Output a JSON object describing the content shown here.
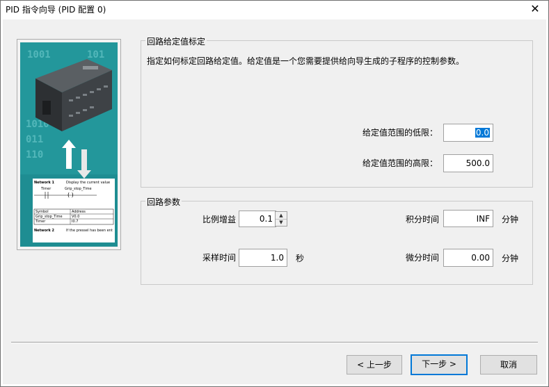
{
  "window": {
    "title": "PID 指令向导 (PID 配置 0)",
    "close_glyph": "✕"
  },
  "illustration": {
    "bits_lines": [
      "1001",
      "101",
      "1010",
      "011",
      "110"
    ],
    "ladder": {
      "network1": "Network 1",
      "network1_comment": "Display the current value",
      "contact": "Timer",
      "coil": "Grip_stop_Time",
      "table_headers": [
        "Symbol",
        "Address"
      ],
      "table_rows": [
        [
          "Grip_stop_Time",
          "V0.0"
        ],
        [
          "Timer",
          "I0.7"
        ]
      ],
      "network2": "Network 2",
      "network2_comment": "If the pressel has been ent"
    }
  },
  "setpoint_group": {
    "legend": "回路给定值标定",
    "description": "指定如何标定回路给定值。给定值是一个您需要提供给向导生成的子程序的控制参数。",
    "low_label": "给定值范围的低限：",
    "low_value": "0.0",
    "high_label": "给定值范围的高限：",
    "high_value": "500.0"
  },
  "loop_params": {
    "legend": "回路参数",
    "gain_label": "比例增益",
    "gain_value": "0.1",
    "sample_label": "采样时间",
    "sample_value": "1.0",
    "sample_unit": "秒",
    "integral_label": "积分时间",
    "integral_value": "INF",
    "integral_unit": "分钟",
    "derivative_label": "微分时间",
    "derivative_value": "0.00",
    "derivative_unit": "分钟"
  },
  "buttons": {
    "back": "< 上一步",
    "next": "下一步 >",
    "cancel": "取消"
  },
  "colors": {
    "illustration_bg": "#1e8d92",
    "selection": "#0078d7",
    "default_button_border": "#0078d7"
  }
}
